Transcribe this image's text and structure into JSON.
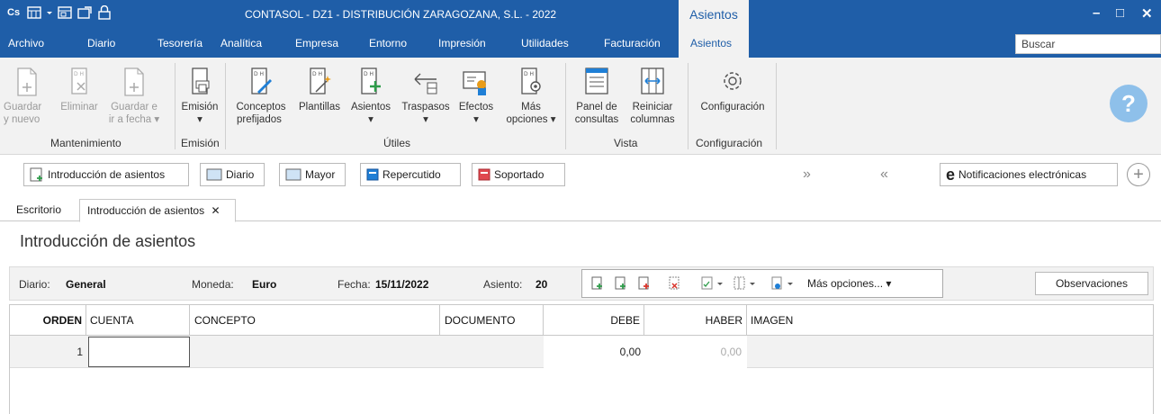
{
  "title_bar": {
    "app_logo": "Cs",
    "title": "CONTASOL - DZ1 - DISTRIBUCIÓN ZARAGOZANA, S.L. - 2022",
    "context_tab_title": "Asientos",
    "minimize": "–",
    "maximize": "□",
    "close": "✕",
    "quick_icons": [
      "calendar-icon",
      "window-icon",
      "export-icon",
      "lock-icon"
    ]
  },
  "menu": {
    "tabs": [
      "Archivo",
      "Diario",
      "Tesorería",
      "Analítica",
      "Empresa",
      "Entorno",
      "Impresión",
      "Utilidades",
      "Facturación",
      "Asientos"
    ],
    "active": "Asientos",
    "search_placeholder": "Buscar"
  },
  "ribbon": {
    "mantenimiento": {
      "label": "Mantenimiento",
      "guardar_nuevo": [
        "Guardar",
        "y nuevo"
      ],
      "eliminar": [
        "Eliminar"
      ],
      "guardar_fecha": [
        "Guardar e",
        "ir a fecha ▾"
      ]
    },
    "emision": {
      "label": "Emisión",
      "button": [
        "Emisión",
        "▾"
      ]
    },
    "utiles": {
      "label": "Útiles",
      "conceptos": [
        "Conceptos",
        "prefijados"
      ],
      "plantillas": [
        "Plantillas"
      ],
      "asientos": [
        "Asientos",
        "▾"
      ],
      "traspasos": [
        "Traspasos",
        "▾"
      ],
      "efectos": [
        "Efectos",
        "▾"
      ],
      "mas_opciones": [
        "Más",
        "opciones ▾"
      ]
    },
    "vista": {
      "label": "Vista",
      "panel": [
        "Panel de",
        "consultas"
      ],
      "reiniciar": [
        "Reiniciar",
        "columnas"
      ]
    },
    "configuracion": {
      "label": "Configuración",
      "button": [
        "Configuración"
      ]
    },
    "help": "?"
  },
  "quickbar": {
    "introduccion": "Introducción de asientos",
    "diario": "Diario",
    "mayor": "Mayor",
    "repercutido": "Repercutido",
    "soportado": "Soportado",
    "next": "»",
    "prev": "«",
    "notificaciones": "Notificaciones electrónicas",
    "add": "+"
  },
  "doc_tabs": {
    "escritorio": "Escritorio",
    "active": "Introducción de asientos",
    "close": "✕"
  },
  "page_title": "Introducción de asientos",
  "info": {
    "diario_label": "Diario:",
    "diario_value": "General",
    "moneda_label": "Moneda:",
    "moneda_value": "Euro",
    "fecha_label": "Fecha:",
    "fecha_value": "15/11/2022",
    "asiento_label": "Asiento:",
    "asiento_value": "20",
    "mas_opciones": "Más opciones...",
    "observaciones": "Observaciones"
  },
  "grid": {
    "columns": [
      "ORDEN",
      "CUENTA",
      "CONCEPTO",
      "DOCUMENTO",
      "DEBE",
      "HABER",
      "IMAGEN"
    ],
    "rows": [
      {
        "orden": "1",
        "cuenta": "",
        "concepto": "",
        "documento": "",
        "debe": "0,00",
        "haber": "0,00",
        "imagen": ""
      }
    ]
  },
  "colors": {
    "title_bar": "#1f5ea8",
    "ribbon_bg": "#f2f2f2",
    "green_icon": "#2e9c4a",
    "red_icon": "#d9342b",
    "help_circle": "#8ec0ea"
  }
}
